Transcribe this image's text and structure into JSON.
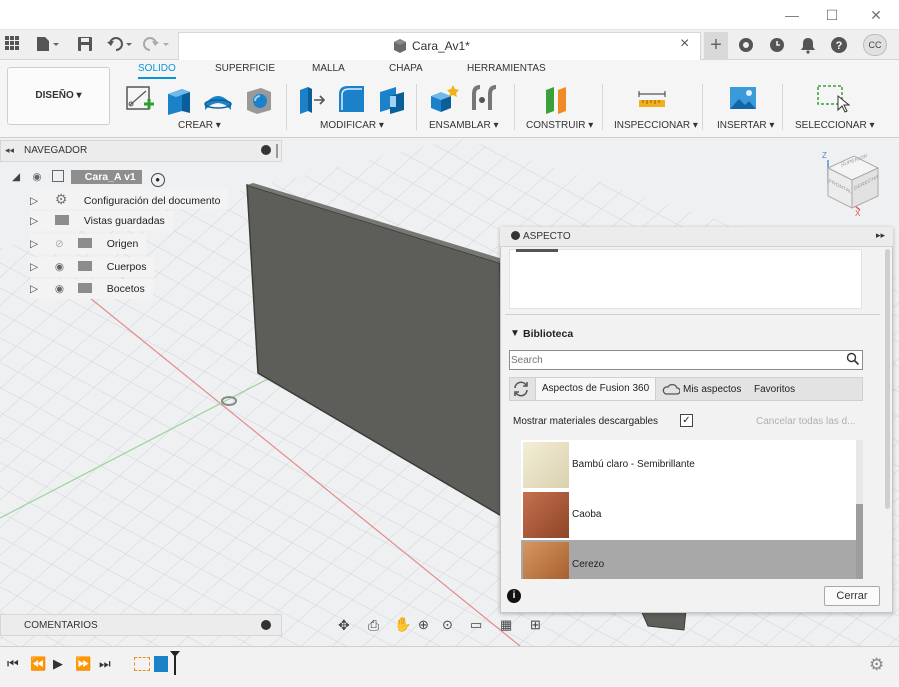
{
  "window": {
    "minimize": "—",
    "maximize": "☐",
    "close": "✕"
  },
  "document": {
    "tab_title": "Cara_Av1*",
    "tab_close": "×",
    "add_tab": "+",
    "user_initials": "CC"
  },
  "workspace": {
    "label": "DISEÑO ▾"
  },
  "ribbon_tabs": [
    "SOLIDO",
    "SUPERFICIE",
    "MALLA",
    "CHAPA",
    "HERRAMIENTAS"
  ],
  "groups": {
    "crear": "CREAR ▾",
    "modificar": "MODIFICAR ▾",
    "ensamblar": "ENSAMBLAR ▾",
    "construir": "CONSTRUIR ▾",
    "inspeccionar": "INSPECCIONAR ▾",
    "insertar": "INSERTAR ▾",
    "seleccionar": "SELECCIONAR ▾"
  },
  "browser": {
    "header": "NAVEGADOR",
    "root": "Cara_A v1",
    "items": [
      "Configuración del documento",
      "Vistas guardadas",
      "Origen",
      "Cuerpos",
      "Bocetos"
    ]
  },
  "viewcube": {
    "top": "SUPERIOR",
    "front": "FRONTAL",
    "right": "DERECHA",
    "axis_z": "Z",
    "axis_x": "X"
  },
  "appearance": {
    "title": "ASPECTO",
    "expand": "▸▸",
    "library_label": "Biblioteca",
    "search_placeholder": "Search",
    "tabs": [
      "Aspectos de Fusion 360",
      "Mis aspectos",
      "Favoritos"
    ],
    "show_downloadable": "Mostrar materiales descargables",
    "cancel_all": "Cancelar todas las d...",
    "materials": [
      {
        "name": "Bambú claro - Semibrillante",
        "color": "#e9e2c4"
      },
      {
        "name": "Caoba",
        "color": "#a9583a"
      },
      {
        "name": "Cerezo",
        "color": "#c07a47"
      }
    ],
    "close_button": "Cerrar"
  },
  "comments": {
    "label": "COMENTARIOS"
  },
  "colors": {
    "accent": "#0696d7",
    "panel_body": "#5d5e59",
    "panel_edge": "#3b3c38"
  }
}
